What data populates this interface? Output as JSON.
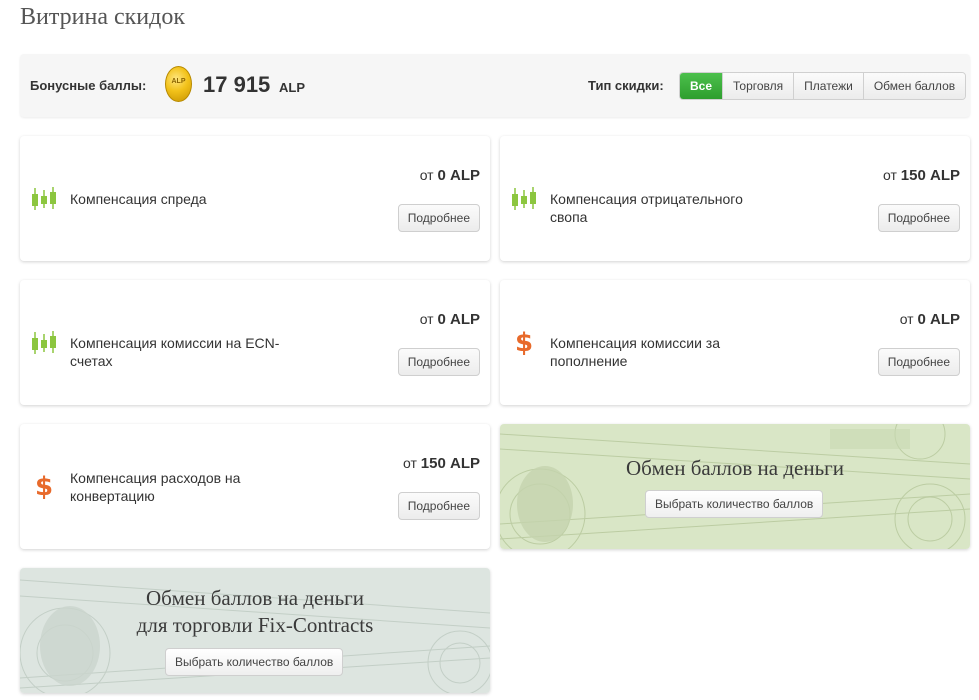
{
  "page": {
    "title": "Витрина скидок"
  },
  "bonus": {
    "label": "Бонусные баллы:",
    "coin_text": "ALP",
    "amount": "17 915",
    "unit": "ALP"
  },
  "filter": {
    "label": "Тип скидки:",
    "options": [
      "Все",
      "Торговля",
      "Платежи",
      "Обмен баллов"
    ],
    "active": "Все",
    "active_color": "#3aae3a"
  },
  "cards": [
    {
      "icon": "candlestick-chart-icon",
      "name": "Компенсация спреда",
      "price_prefix": "от",
      "price_value": "0 ALP",
      "button": "Подробнее"
    },
    {
      "icon": "candlestick-chart-icon",
      "name": "Компенсация отрицательного свопа",
      "price_prefix": "от",
      "price_value": "150 ALP",
      "button": "Подробнее"
    },
    {
      "icon": "candlestick-chart-icon",
      "name": "Компенсация комиссии на ECN-счетах",
      "price_prefix": "от",
      "price_value": "0 ALP",
      "button": "Подробнее"
    },
    {
      "icon": "dollar-icon",
      "name": "Компенсация комиссии за пополнение",
      "price_prefix": "от",
      "price_value": "0 ALP",
      "button": "Подробнее"
    },
    {
      "icon": "dollar-icon",
      "name": "Компенсация расходов на конвертацию",
      "price_prefix": "от",
      "price_value": "150 ALP",
      "button": "Подробнее"
    }
  ],
  "banners": [
    {
      "title_line1": "Обмен баллов на деньги",
      "title_line2": "",
      "button": "Выбрать количество баллов"
    },
    {
      "title_line1": "Обмен баллов на деньги",
      "title_line2": "для торговли Fix-Contracts",
      "button": "Выбрать количество баллов"
    }
  ],
  "icons": {
    "dollar_glyph": "$"
  },
  "colors": {
    "green_icon": "#8cc63f",
    "orange_icon": "#e86a2b",
    "banner_green": "#d9e6c6",
    "banner_grey": "#dde5e0"
  }
}
